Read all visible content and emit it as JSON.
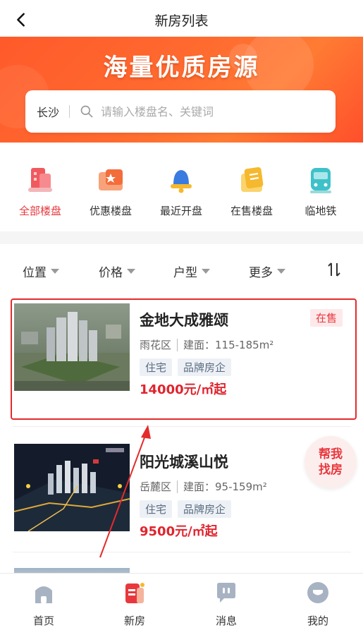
{
  "header": {
    "title": "新房列表"
  },
  "banner": {
    "title": "海量优质房源"
  },
  "search": {
    "city": "长沙",
    "placeholder": "请输入楼盘名、关键词"
  },
  "categories": [
    {
      "label": "全部楼盘",
      "icon": "building-icon",
      "active": true
    },
    {
      "label": "优惠楼盘",
      "icon": "coupon-icon",
      "active": false
    },
    {
      "label": "最近开盘",
      "icon": "bell-icon",
      "active": false
    },
    {
      "label": "在售楼盘",
      "icon": "sale-doc-icon",
      "active": false
    },
    {
      "label": "临地铁",
      "icon": "subway-icon",
      "active": false
    }
  ],
  "filters": [
    {
      "label": "位置"
    },
    {
      "label": "价格"
    },
    {
      "label": "户型"
    },
    {
      "label": "更多"
    }
  ],
  "listings": [
    {
      "name": "金地大成雅颂",
      "district": "雨花区",
      "area": "建面：115-185m²",
      "tags": [
        "住宅",
        "品牌房企"
      ],
      "price": "14000元/㎡起",
      "status": "在售"
    },
    {
      "name": "阳光城溪山悦",
      "district": "岳麓区",
      "area": "建面：95-159m²",
      "tags": [
        "住宅",
        "品牌房企"
      ],
      "price": "9500元/㎡起",
      "status": ""
    }
  ],
  "help_button": {
    "line1": "帮我",
    "line2": "找房"
  },
  "bottom_nav": [
    {
      "label": "首页",
      "icon": "home-icon",
      "active": false
    },
    {
      "label": "新房",
      "icon": "new-house-icon",
      "active": true
    },
    {
      "label": "消息",
      "icon": "message-icon",
      "active": false
    },
    {
      "label": "我的",
      "icon": "profile-icon",
      "active": false
    }
  ],
  "colors": {
    "accent": "#e8383d",
    "banner": "#ff6a2f",
    "price": "#e0242e",
    "highlight": "#e42b2b"
  }
}
